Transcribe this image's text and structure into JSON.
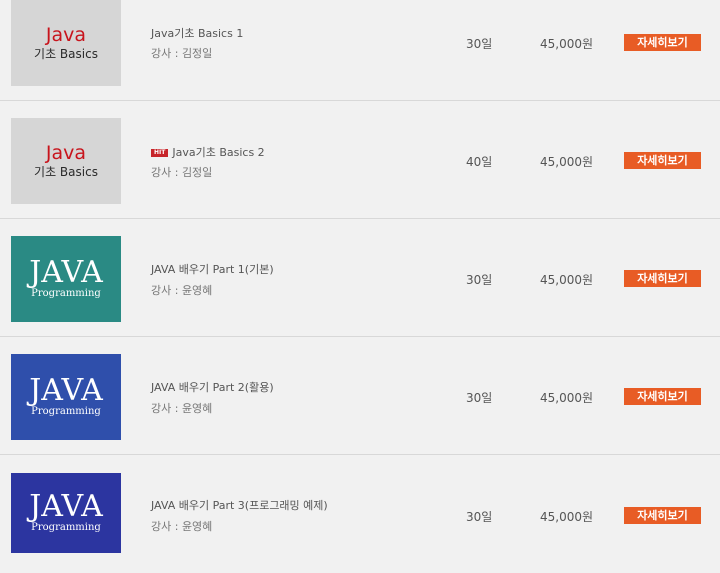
{
  "courses": [
    {
      "thumb_title": "Java",
      "thumb_subtitle": "기초 Basics",
      "thumb_color": "#d6d6d6",
      "title": "Java기초 Basics 1",
      "hit": "",
      "teacher": "강사 : 김정일",
      "period": "30일",
      "price": "45,000원",
      "button": "자세히보기"
    },
    {
      "thumb_title": "Java",
      "thumb_subtitle": "기초 Basics",
      "thumb_color": "#d6d6d6",
      "title": "Java기초 Basics 2",
      "hit": "HIT",
      "teacher": "강사 : 김정일",
      "period": "40일",
      "price": "45,000원",
      "button": "자세히보기"
    },
    {
      "thumb_title": "JAVA",
      "thumb_subtitle": "Programming",
      "thumb_color": "#2a8a84",
      "title": "JAVA 배우기 Part 1(기본)",
      "hit": "",
      "teacher": "강사 : 윤영혜",
      "period": "30일",
      "price": "45,000원",
      "button": "자세히보기"
    },
    {
      "thumb_title": "JAVA",
      "thumb_subtitle": "Programming",
      "thumb_color": "#2f4fab",
      "title": "JAVA 배우기 Part 2(활용)",
      "hit": "",
      "teacher": "강사 : 윤영혜",
      "period": "30일",
      "price": "45,000원",
      "button": "자세히보기"
    },
    {
      "thumb_title": "JAVA",
      "thumb_subtitle": "Programming",
      "thumb_color": "#2c35a0",
      "title": "JAVA 배우기 Part 3(프로그래밍 예제)",
      "hit": "",
      "teacher": "강사 : 윤영혜",
      "period": "30일",
      "price": "45,000원",
      "button": "자세히보기"
    }
  ]
}
